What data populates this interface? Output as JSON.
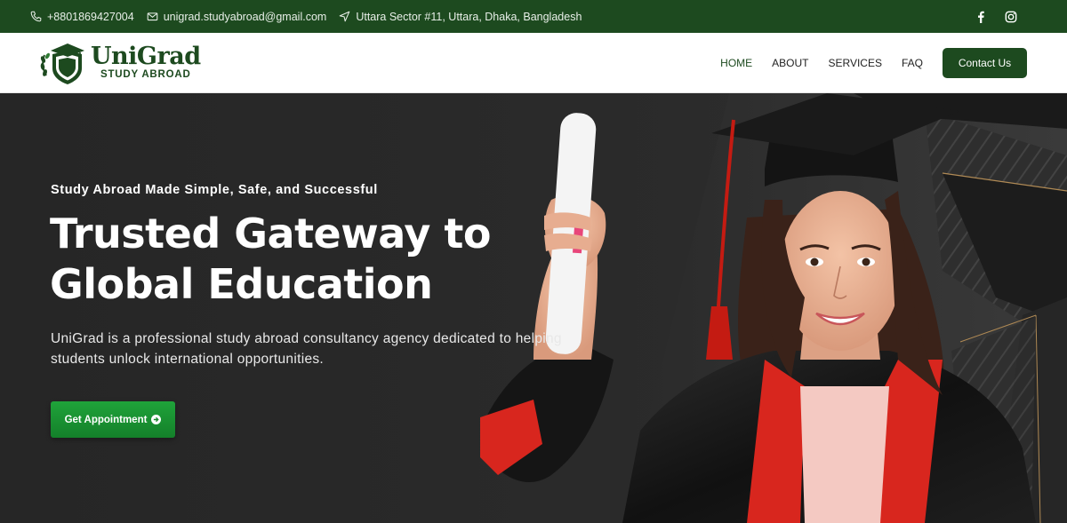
{
  "topbar": {
    "phone": "+8801869427004",
    "email": "unigrad.studyabroad@gmail.com",
    "address": "Uttara Sector #11, Uttara, Dhaka, Bangladesh",
    "icons": {
      "phone": "phone-icon",
      "email": "mail-icon",
      "address": "location-arrow-icon",
      "facebook": "facebook-icon",
      "instagram": "instagram-icon"
    },
    "background": "#1d4a1f"
  },
  "header": {
    "logo_name": "UniGrad",
    "logo_sub": "STUDY ABROAD",
    "nav": [
      {
        "label": "HOME",
        "active": true
      },
      {
        "label": "ABOUT",
        "active": false
      },
      {
        "label": "SERVICES",
        "active": false
      },
      {
        "label": "FAQ",
        "active": false
      }
    ],
    "contact_button": "Contact Us"
  },
  "hero": {
    "eyebrow": "Study Abroad Made Simple, Safe, and Successful",
    "title": "Trusted Gateway to Global Education",
    "description": "UniGrad is a professional study abroad consultancy agency dedicated to helping students unlock international opportunities.",
    "cta_label": "Get Appointment",
    "cta_icon": "arrow-circle-right-icon",
    "accent": "#1fa33a"
  }
}
